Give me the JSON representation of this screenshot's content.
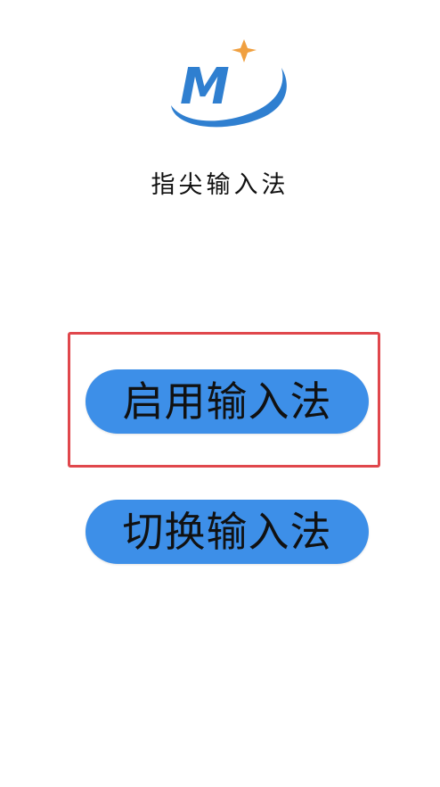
{
  "app": {
    "title": "指尖输入法",
    "logo_letter": "M"
  },
  "buttons": {
    "enable_label": "启用输入法",
    "switch_label": "切换输入法"
  },
  "colors": {
    "button_bg": "#3d8fe8",
    "logo_blue": "#2f7fd0",
    "logo_star": "#f0a040",
    "highlight_border": "#e0474c"
  }
}
